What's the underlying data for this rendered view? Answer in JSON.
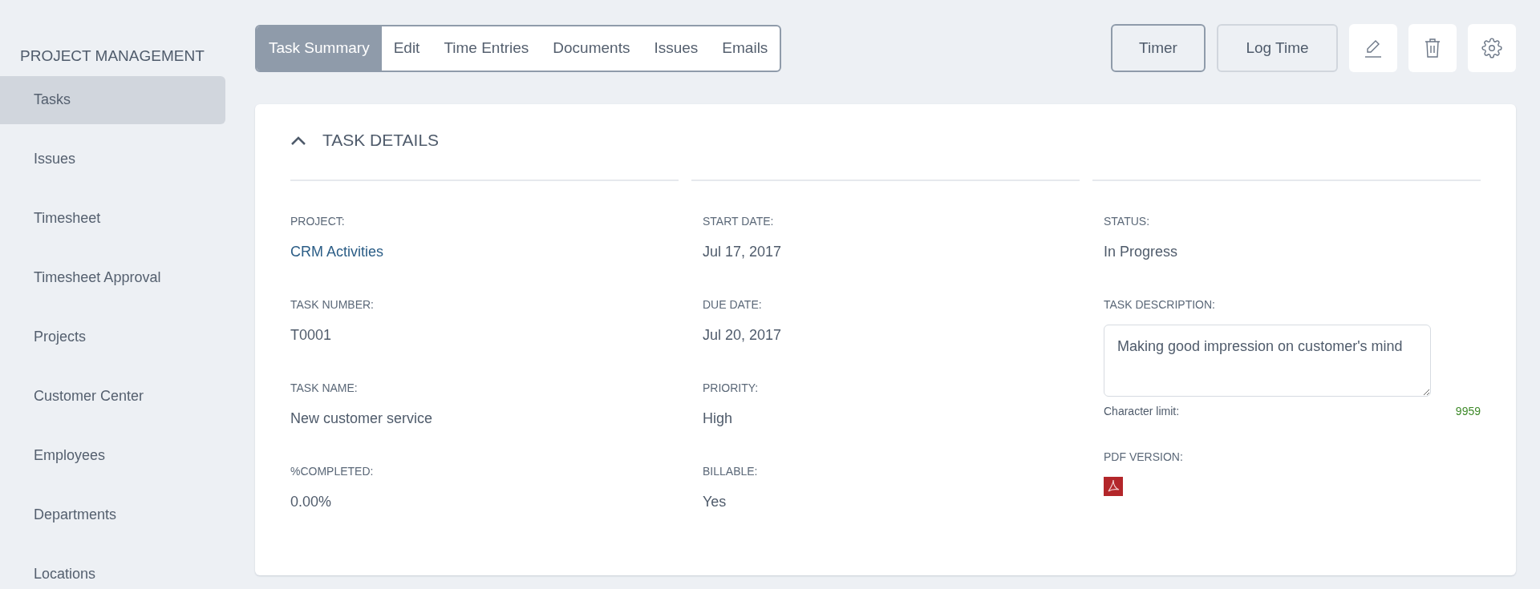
{
  "sidebar": {
    "title": "PROJECT MANAGEMENT",
    "items": [
      {
        "label": "Tasks",
        "selected": true
      },
      {
        "label": "Issues",
        "selected": false
      },
      {
        "label": "Timesheet",
        "selected": false
      },
      {
        "label": "Timesheet Approval",
        "selected": false
      },
      {
        "label": "Projects",
        "selected": false
      },
      {
        "label": "Customer Center",
        "selected": false
      },
      {
        "label": "Employees",
        "selected": false
      },
      {
        "label": "Departments",
        "selected": false
      },
      {
        "label": "Locations",
        "selected": false
      }
    ]
  },
  "tabs": [
    {
      "label": "Task Summary",
      "selected": true
    },
    {
      "label": "Edit",
      "selected": false
    },
    {
      "label": "Time Entries",
      "selected": false
    },
    {
      "label": "Documents",
      "selected": false
    },
    {
      "label": "Issues",
      "selected": false
    },
    {
      "label": "Emails",
      "selected": false
    }
  ],
  "toolbar": {
    "buttons": [
      {
        "label": "Timer",
        "kind": "primary"
      },
      {
        "label": "Log Time",
        "kind": "secondary"
      }
    ],
    "icons": [
      {
        "kind": "edit"
      },
      {
        "kind": "delete"
      },
      {
        "kind": "settings"
      }
    ]
  },
  "section": {
    "title": "TASK DETAILS",
    "expanded": true,
    "columns": [
      [
        {
          "label": "PROJECT:",
          "value": "CRM Activities",
          "kind": "link"
        },
        {
          "label": "TASK NUMBER:",
          "value": "T0001",
          "kind": "text"
        },
        {
          "label": "TASK NAME:",
          "value": "New customer service",
          "kind": "text"
        },
        {
          "label": "%COMPLETED:",
          "value": "0.00%",
          "kind": "text"
        }
      ],
      [
        {
          "label": "START DATE:",
          "value": "Jul 17, 2017",
          "kind": "text"
        },
        {
          "label": "DUE DATE:",
          "value": "Jul 20, 2017",
          "kind": "text"
        },
        {
          "label": "PRIORITY:",
          "value": "High",
          "kind": "text"
        },
        {
          "label": "BILLABLE:",
          "value": "Yes",
          "kind": "text"
        }
      ],
      [
        {
          "label": "STATUS:",
          "value": "In Progress",
          "kind": "text"
        },
        {
          "label": "TASK DESCRIPTION:",
          "value": "Making good impression on customer's mind",
          "kind": "textarea",
          "limit_label": "Character limit:",
          "limit_value": "9959"
        },
        {
          "label": "PDF VERSION:",
          "kind": "pdf"
        }
      ]
    ]
  }
}
